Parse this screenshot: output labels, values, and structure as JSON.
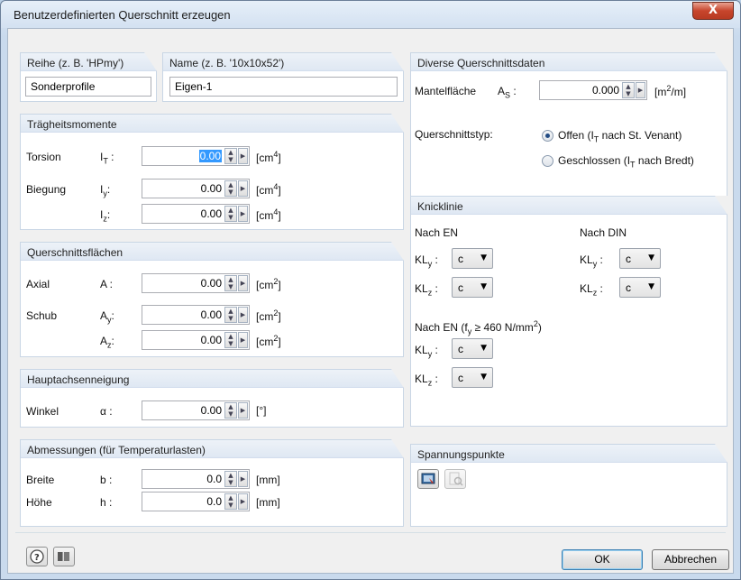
{
  "window": {
    "title": "Benutzerdefinierten Querschnitt erzeugen",
    "close_label": "X"
  },
  "naming": {
    "series_label": "Reihe (z. B. 'HPmy')",
    "series_value": "Sonderprofile",
    "name_label": "Name  (z. B. '10x10x52')",
    "name_value": "Eigen-1"
  },
  "inertia": {
    "header": "Trägheitsmomente",
    "torsion_label": "Torsion",
    "torsion_sym": "I",
    "torsion_sub": "T",
    "torsion_value": "0.00",
    "bending_label": "Biegung",
    "iy_sym": "I",
    "iy_sub": "y",
    "iy_value": "0.00",
    "iz_sym": "I",
    "iz_sub": "z",
    "iz_value": "0.00",
    "unit": "[cm",
    "unit_exp": "4",
    "unit_end": "]"
  },
  "areas": {
    "header": "Querschnittsflächen",
    "axial_label": "Axial",
    "a_sym": "A :",
    "a_value": "0.00",
    "shear_label": "Schub",
    "ay_sym": "A",
    "ay_sub": "y",
    "ay_value": "0.00",
    "az_sym": "A",
    "az_sub": "z",
    "az_value": "0.00",
    "unit": "[cm",
    "unit_exp": "2",
    "unit_end": "]"
  },
  "axis": {
    "header": "Hauptachsenneigung",
    "angle_label": "Winkel",
    "angle_sym": "α :",
    "angle_value": "0.00",
    "unit": "[°]"
  },
  "dimensions": {
    "header": "Abmessungen (für Temperaturlasten)",
    "width_label": "Breite",
    "width_sym": "b :",
    "width_value": "0.0",
    "height_label": "Höhe",
    "height_sym": "h :",
    "height_value": "0.0",
    "unit": "[mm]"
  },
  "misc": {
    "header": "Diverse Querschnittsdaten",
    "surface_label": "Mantelfläche",
    "surface_sym": "A",
    "surface_sub": "S",
    "surface_value": "0.000",
    "surface_unit_a": "[m",
    "surface_unit_exp": "2",
    "surface_unit_b": "/m]",
    "type_label": "Querschnittstyp:",
    "open_label": "Offen (I",
    "open_sub": "T",
    "open_label_end": "nach St. Venant)",
    "closed_label": "Geschlossen (I",
    "closed_sub": "T",
    "closed_label_end": "nach Bredt)",
    "selected": "open"
  },
  "buckling": {
    "header": "Knicklinie",
    "en_label": "Nach EN",
    "din_label": "Nach DIN",
    "kl_sym": "KL",
    "y_sub": "y",
    "z_sub": "z",
    "en_kly": "c",
    "en_klz": "c",
    "din_kly": "c",
    "din_klz": "c",
    "en460_label": "Nach EN (f",
    "en460_sub": "y",
    "en460_label_end": "≥ 460 N/mm",
    "en460_exp": "2",
    "en460_close": ")",
    "en460_kly": "c",
    "en460_klz": "c"
  },
  "stress": {
    "header": "Spannungspunkte"
  },
  "footer": {
    "ok_label": "OK",
    "cancel_label": "Abbrechen"
  },
  "icons": [
    "help-icon",
    "book-icon",
    "stress-points-edit-icon",
    "stress-points-view-icon"
  ]
}
